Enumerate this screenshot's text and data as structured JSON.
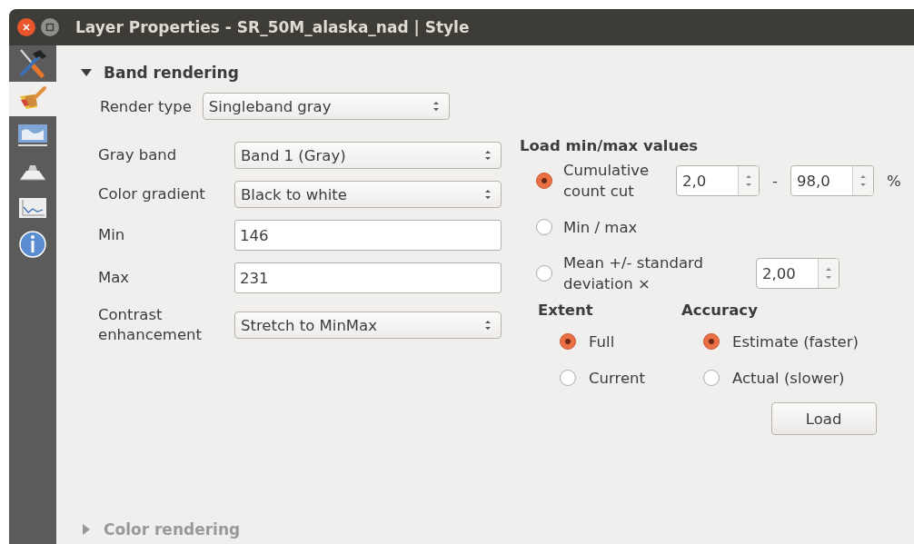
{
  "window": {
    "title": "Layer Properties - SR_50M_alaska_nad | Style"
  },
  "sidebar": {
    "items": [
      {
        "selected": false
      },
      {
        "selected": true
      },
      {
        "selected": false
      },
      {
        "selected": false
      },
      {
        "selected": false
      },
      {
        "selected": false
      }
    ]
  },
  "band_rendering": {
    "title": "Band rendering",
    "expanded": true,
    "render_type": {
      "label": "Render type",
      "value": "Singleband gray"
    },
    "fields": [
      {
        "kind": "combo",
        "label": "Gray band",
        "value": "Band 1 (Gray)"
      },
      {
        "kind": "combo",
        "label": "Color gradient",
        "value": "Black to white"
      },
      {
        "kind": "text",
        "label": "Min",
        "value": "146"
      },
      {
        "kind": "text",
        "label": "Max",
        "value": "231"
      },
      {
        "kind": "combo",
        "label": "Contrast enhancement",
        "value": "Stretch to MinMax"
      }
    ],
    "load_minmax": {
      "title": "Load min/max values",
      "options": [
        {
          "label": "Cumulative count cut",
          "selected": true,
          "from": "2,0",
          "separator": "-",
          "to": "98,0",
          "unit": "%"
        },
        {
          "label": "Min / max",
          "selected": false
        },
        {
          "label": "Mean +/- standard deviation ×",
          "selected": false,
          "factor": "2,00"
        }
      ],
      "extent": {
        "title": "Extent",
        "options": [
          {
            "label": "Full",
            "selected": true
          },
          {
            "label": "Current",
            "selected": false
          }
        ]
      },
      "accuracy": {
        "title": "Accuracy",
        "options": [
          {
            "label": "Estimate (faster)",
            "selected": true
          },
          {
            "label": "Actual (slower)",
            "selected": false
          }
        ]
      },
      "load_button": "Load"
    }
  },
  "color_rendering": {
    "title": "Color rendering",
    "expanded": false
  }
}
